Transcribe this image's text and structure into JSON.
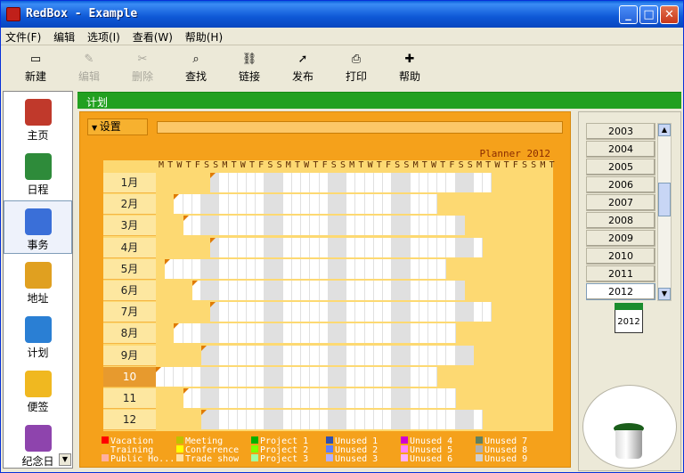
{
  "window": {
    "title": "RedBox - Example"
  },
  "menu": [
    {
      "label": "文件(F)"
    },
    {
      "label": "编辑"
    },
    {
      "label": "选项(I)"
    },
    {
      "label": "查看(W)"
    },
    {
      "label": "帮助(H)"
    }
  ],
  "toolbar": [
    {
      "label": "新建",
      "icon": "new-icon",
      "enabled": true
    },
    {
      "label": "编辑",
      "icon": "edit-icon",
      "enabled": false
    },
    {
      "label": "删除",
      "icon": "delete-icon",
      "enabled": false
    },
    {
      "label": "查找",
      "icon": "find-icon",
      "enabled": true
    },
    {
      "label": "链接",
      "icon": "link-icon",
      "enabled": true
    },
    {
      "label": "发布",
      "icon": "publish-icon",
      "enabled": true
    },
    {
      "label": "打印",
      "icon": "print-icon",
      "enabled": true
    },
    {
      "label": "帮助",
      "icon": "help-icon",
      "enabled": true
    }
  ],
  "sidebar": [
    {
      "label": "主页",
      "icon": "home-icon",
      "color": "#c0392b"
    },
    {
      "label": "日程",
      "icon": "calendar-icon",
      "color": "#2e8b3a"
    },
    {
      "label": "事务",
      "icon": "clipboard-icon",
      "color": "#3a6fd8"
    },
    {
      "label": "地址",
      "icon": "contacts-icon",
      "color": "#e0a020"
    },
    {
      "label": "计划",
      "icon": "plan-icon",
      "color": "#2a7fd4"
    },
    {
      "label": "便签",
      "icon": "note-icon",
      "color": "#f0b820"
    },
    {
      "label": "纪念日",
      "icon": "gift-icon",
      "color": "#8e44ad"
    }
  ],
  "section": {
    "title": "计划"
  },
  "settings": {
    "label": "设置"
  },
  "planner": {
    "title": "Planner 2012",
    "day_header": "MTWTFSSMTWTFSSMTWTFSSMTWTFSSMTWTFSSMTWTFSSMT",
    "current_month": "10",
    "months": [
      "1月",
      "2月",
      "3月",
      "4月",
      "5月",
      "6月",
      "7月",
      "8月",
      "9月",
      "10",
      "11",
      "12"
    ]
  },
  "legend": [
    {
      "label": "Vacation",
      "color": "#ff0000"
    },
    {
      "label": "Training",
      "color": "#f7a51b"
    },
    {
      "label": "Public Ho...",
      "color": "#ffb0a0"
    },
    {
      "label": "Meeting",
      "color": "#c0c000"
    },
    {
      "label": "Conference",
      "color": "#ffff00"
    },
    {
      "label": "Trade show",
      "color": "#ffe0a0"
    },
    {
      "label": "Project 1",
      "color": "#00b000"
    },
    {
      "label": "Project 2",
      "color": "#80ff00"
    },
    {
      "label": "Project 3",
      "color": "#a0ffa0"
    },
    {
      "label": "Unused 1",
      "color": "#3050b0"
    },
    {
      "label": "Unused 2",
      "color": "#6080ff"
    },
    {
      "label": "Unused 3",
      "color": "#b0b0ff"
    },
    {
      "label": "Unused 4",
      "color": "#d000d0"
    },
    {
      "label": "Unused 5",
      "color": "#ff80ff"
    },
    {
      "label": "Unused 6",
      "color": "#ffb0ff"
    },
    {
      "label": "Unused 7",
      "color": "#608060"
    },
    {
      "label": "Unused 8",
      "color": "#b0b0b0"
    },
    {
      "label": "Unused 9",
      "color": "#d0d0d0"
    }
  ],
  "years": [
    "2003",
    "2004",
    "2005",
    "2006",
    "2007",
    "2008",
    "2009",
    "2010",
    "2011",
    "2012"
  ],
  "selected_year": "2012",
  "mini_calendar": "2012"
}
